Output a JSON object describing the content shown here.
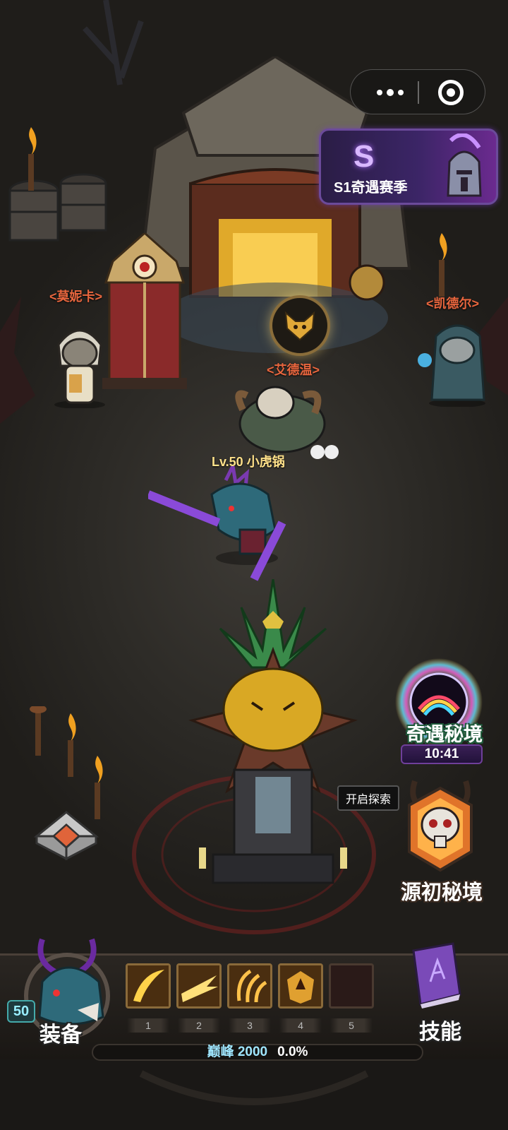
{
  "system": {
    "capsule_more_icon": "more-dots-icon",
    "capsule_close_icon": "target-close-icon"
  },
  "season_banner": {
    "logo": "S",
    "title": "S1奇遇赛季"
  },
  "npcs": {
    "left": "<莫妮卡>",
    "center": "<艾德温>",
    "right": "<凯德尔>"
  },
  "player": {
    "label": "Lv.50 小虎锅"
  },
  "right_menu": {
    "secret_realm_label": "奇遇秘境",
    "secret_realm_timer": "10:41",
    "explore_tip": "开启探索",
    "origin_realm_label": "源初秘境"
  },
  "hud": {
    "level": "50",
    "equip_label": "装备",
    "skill_label": "技能",
    "skill_slots": [
      "1",
      "2",
      "3",
      "4",
      "5"
    ],
    "peak_label": "巅峰 2000",
    "progress_text": "0.0%",
    "progress_value": 0.0
  },
  "colors": {
    "npc_name": "#e8663e",
    "player_name": "#ffe18a",
    "season_purple": "#3b2566",
    "peak_text": "#9fe6ff"
  }
}
